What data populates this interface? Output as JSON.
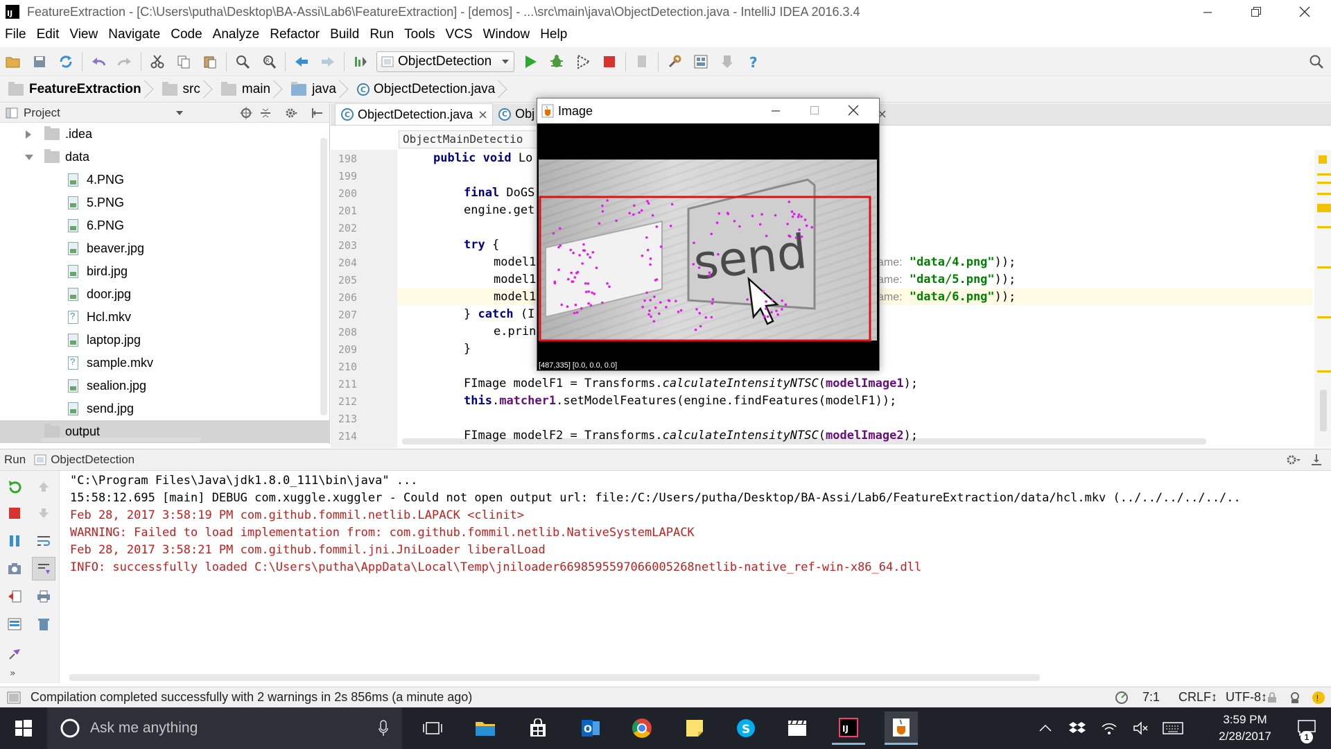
{
  "window": {
    "title": "FeatureExtraction - [C:\\Users\\putha\\Desktop\\BA-Assi\\Lab6\\FeatureExtraction] - [demos] - ...\\src\\main\\java\\ObjectDetection.java - IntelliJ IDEA 2016.3.4",
    "app_icon_label": "IJ"
  },
  "menu": [
    "File",
    "Edit",
    "View",
    "Navigate",
    "Code",
    "Analyze",
    "Refactor",
    "Build",
    "Run",
    "Tools",
    "VCS",
    "Window",
    "Help"
  ],
  "toolbar": {
    "run_config": "ObjectDetection",
    "icons": [
      "open-folder-icon",
      "save-icon",
      "sync-icon",
      "undo-icon",
      "redo-icon",
      "cut-icon",
      "copy-icon",
      "paste-icon",
      "find-icon",
      "replace-icon",
      "back-icon",
      "forward-icon",
      "build-icon",
      "run-icon",
      "debug-icon",
      "coverage-icon",
      "stop-icon",
      "attach-icon",
      "settings-icon",
      "project-structure-icon",
      "sdk-icon",
      "help-icon"
    ]
  },
  "breadcrumbs": [
    {
      "label": "FeatureExtraction",
      "icon": "folder-icon",
      "bold": true
    },
    {
      "label": "src",
      "icon": "folder-icon"
    },
    {
      "label": "main",
      "icon": "folder-icon"
    },
    {
      "label": "java",
      "icon": "folder-icon"
    },
    {
      "label": "ObjectDetection.java",
      "icon": "java-class-icon"
    }
  ],
  "project_panel": {
    "title": "Project",
    "tree": [
      {
        "label": ".idea",
        "type": "folder",
        "depth": 0,
        "expanded": false
      },
      {
        "label": "data",
        "type": "folder",
        "depth": 0,
        "expanded": true
      },
      {
        "label": "4.PNG",
        "type": "image",
        "depth": 1
      },
      {
        "label": "5.PNG",
        "type": "image",
        "depth": 1
      },
      {
        "label": "6.PNG",
        "type": "image",
        "depth": 1
      },
      {
        "label": "beaver.jpg",
        "type": "image",
        "depth": 1
      },
      {
        "label": "bird.jpg",
        "type": "image",
        "depth": 1
      },
      {
        "label": "door.jpg",
        "type": "image",
        "depth": 1
      },
      {
        "label": "Hcl.mkv",
        "type": "unknown",
        "depth": 1
      },
      {
        "label": "laptop.jpg",
        "type": "image",
        "depth": 1
      },
      {
        "label": "sample.mkv",
        "type": "unknown",
        "depth": 1
      },
      {
        "label": "sealion.jpg",
        "type": "image",
        "depth": 1
      },
      {
        "label": "send.jpg",
        "type": "image",
        "depth": 1
      },
      {
        "label": "output",
        "type": "folder",
        "depth": 0,
        "expanded": false,
        "selected": true
      }
    ]
  },
  "editor": {
    "tabs": [
      {
        "label": "ObjectDetection.java",
        "active": true
      },
      {
        "label": "Obj",
        "active": false
      }
    ],
    "structure_breadcrumb": "ObjectMainDetectio",
    "line_numbers": [
      "198",
      "199",
      "200",
      "201",
      "202",
      "203",
      "204",
      "205",
      "206",
      "207",
      "208",
      "209",
      "210",
      "211",
      "212",
      "213",
      "214"
    ],
    "code": {
      "l198_kw": "public void",
      "l198_rest": " Lo",
      "l200_kw": "final",
      "l200_rest": " DoGS",
      "l201": "engine.get",
      "l203_kw": "try",
      "l203_rest": " {",
      "l204": "model1",
      "l205": "model1",
      "l206": "model1",
      "hint_name": "ame:",
      "l204_str": "\"data/4.png\"",
      "l205_str": "\"data/5.png\"",
      "l206_str": "\"data/6.png\"",
      "l_end": "));",
      "l207_a": "} ",
      "l207_kw": "catch",
      "l207_b": " (I",
      "l208": "e.prin",
      "l209": "}",
      "l211_a": "FImage modelF1 = Transforms.",
      "l211_it": "calculateIntensityNTSC",
      "l211_b": "(",
      "l211_fld": "modelImage1",
      "l211_c": ");",
      "l212_kw": "this",
      "l212_a": ".",
      "l212_fld": "matcher1",
      "l212_b": ".setModelFeatures(engine.findFeatures(modelF1));",
      "l214_a": "FImage modelF2 = Transforms.",
      "l214_it": "calculateIntensityNTSC",
      "l214_b": "(",
      "l214_fld": "modelImage2",
      "l214_c": ");"
    }
  },
  "image_window": {
    "title": "Image",
    "status": "[487,335] [0.0, 0.0, 0.0]",
    "picture_text": "send"
  },
  "run_panel": {
    "label": "Run",
    "config": "ObjectDetection",
    "lines": [
      {
        "text": "\"C:\\Program Files\\Java\\jdk1.8.0_111\\bin\\java\" ...",
        "color": "black"
      },
      {
        "text": "15:58:12.695 [main] DEBUG com.xuggle.xuggler - Could not open output url: file:/C:/Users/putha/Desktop/BA-Assi/Lab6/FeatureExtraction/data/hcl.mkv (../../../../../..",
        "color": "black"
      },
      {
        "text": "Feb 28, 2017 3:58:19 PM com.github.fommil.netlib.LAPACK <clinit>",
        "color": "red"
      },
      {
        "text": "WARNING: Failed to load implementation from: com.github.fommil.netlib.NativeSystemLAPACK",
        "color": "red"
      },
      {
        "text": "Feb 28, 2017 3:58:21 PM com.github.fommil.jni.JniLoader liberalLoad",
        "color": "red"
      },
      {
        "text": "INFO: successfully loaded C:\\Users\\putha\\AppData\\Local\\Temp\\jniloader6698595597066005268netlib-native_ref-win-x86_64.dll",
        "color": "red"
      }
    ]
  },
  "status_bar": {
    "message": "Compilation completed successfully with 2 warnings in 2s 856ms (a minute ago)",
    "position": "7:1",
    "line_sep": "CRLF↕",
    "encoding": "UTF-8↕"
  },
  "taskbar": {
    "search_placeholder": "Ask me anything",
    "time": "3:59 PM",
    "date": "2/28/2017",
    "notification_count": "1"
  },
  "colors": {
    "accent": "#3b85b8",
    "error_text": "#c0201e",
    "run_green": "#2fa82f",
    "stop_red": "#d9322c",
    "keypoint": "#e01ee8",
    "bbox": "#e01010"
  }
}
